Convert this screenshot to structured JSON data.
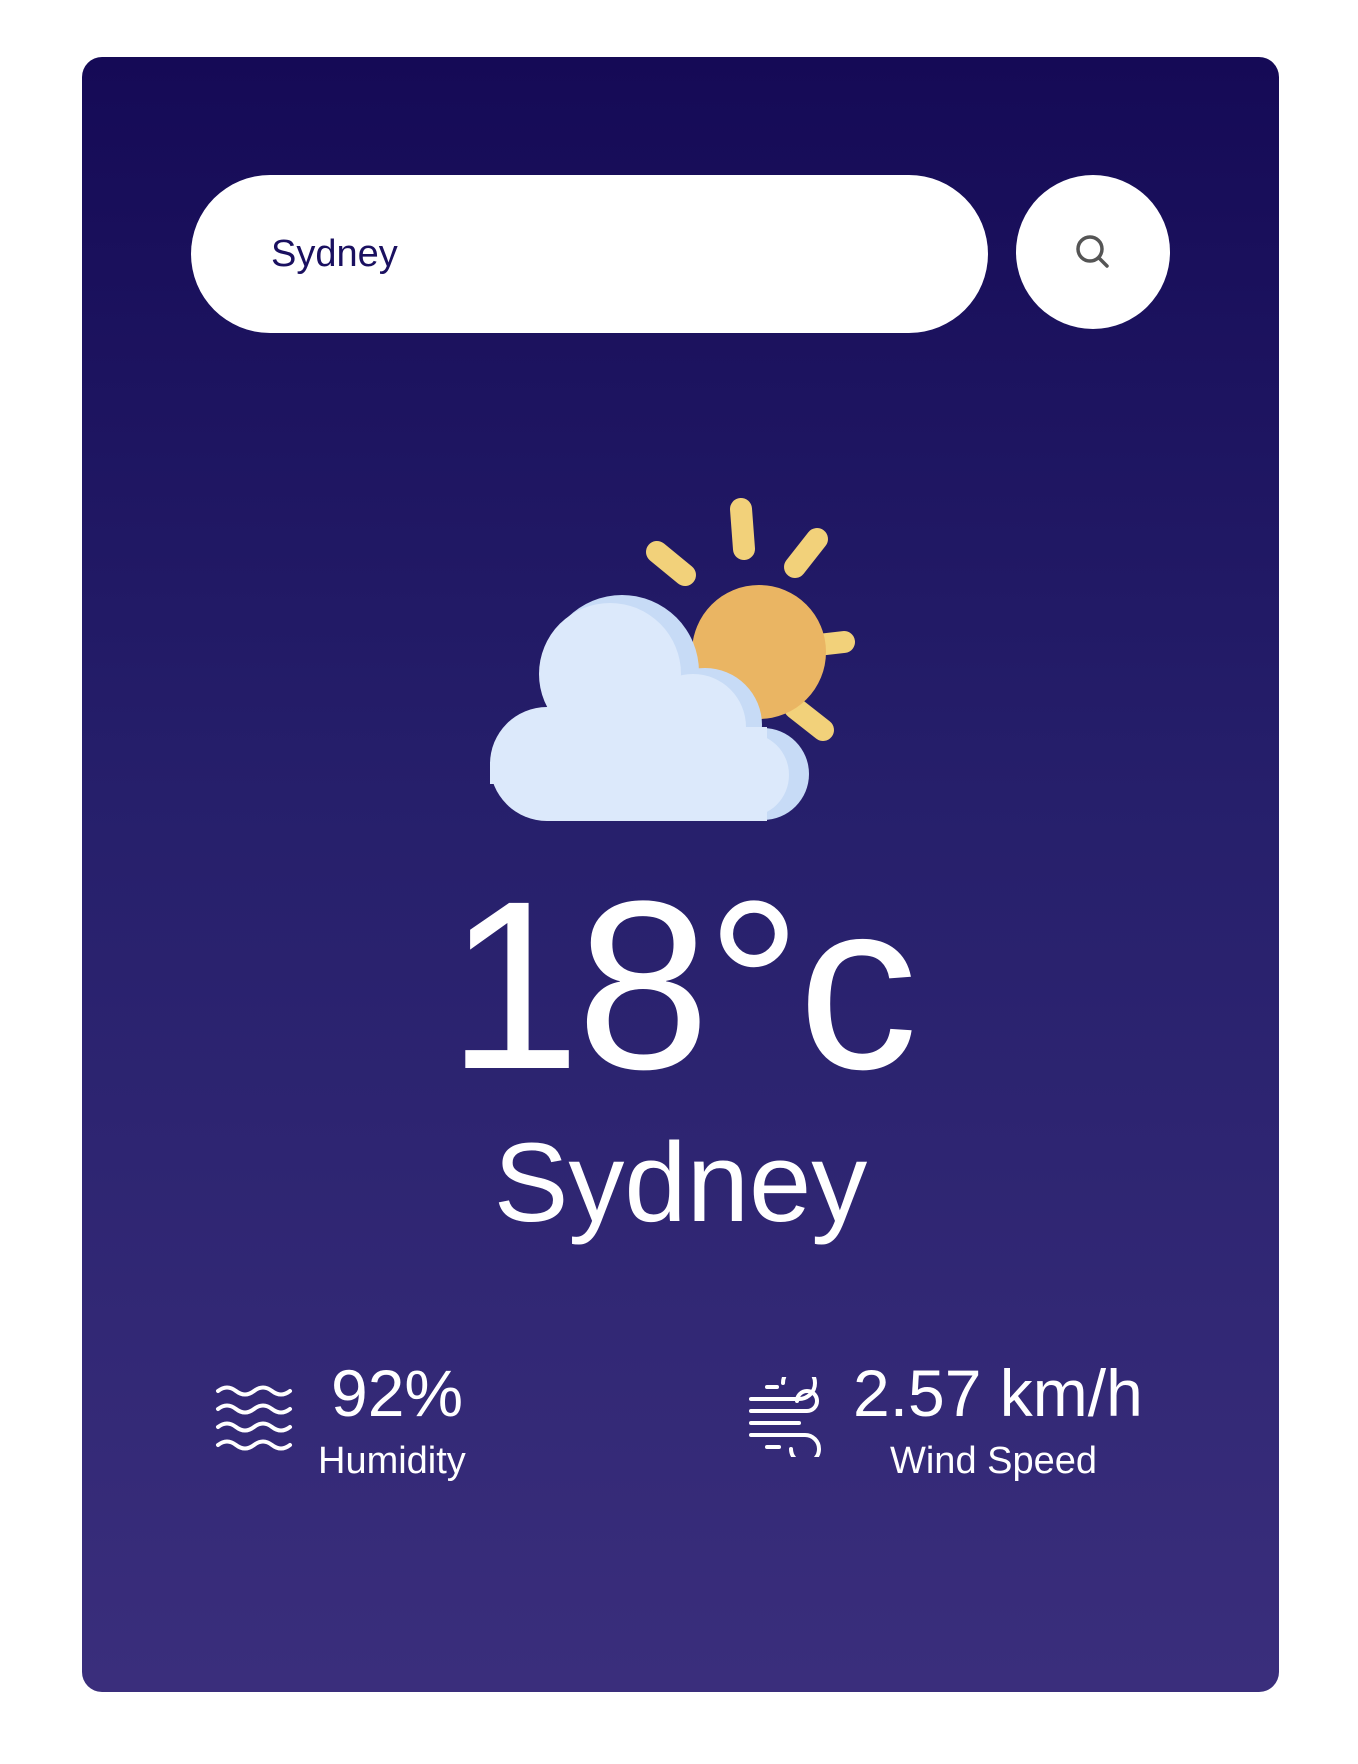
{
  "search": {
    "value": "Sydney",
    "icon": "search-icon"
  },
  "weather": {
    "icon": "partly-cloudy-icon",
    "temperature": "18°c",
    "city": "Sydney"
  },
  "details": {
    "humidity": {
      "value": "92%",
      "label": "Humidity",
      "icon": "humidity-waves-icon"
    },
    "wind": {
      "value": "2.57 km/h",
      "label": "Wind Speed",
      "icon": "wind-icon"
    }
  },
  "colors": {
    "card_top": "#150a56",
    "card_bottom": "#3a2e7c",
    "sun": "#eab563",
    "sun_rays": "#f2d17a",
    "cloud": "#dce9fb",
    "cloud_shade": "#c7dbf6"
  }
}
